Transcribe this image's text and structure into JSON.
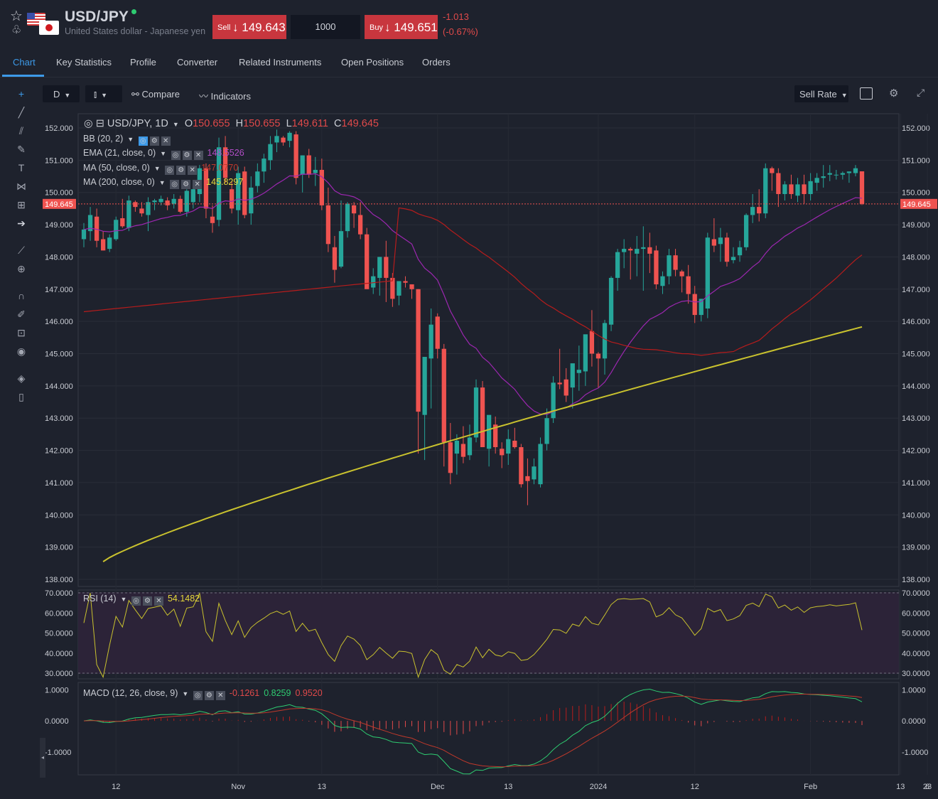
{
  "header": {
    "symbol": "USD/JPY",
    "description": "United States dollar - Japanese yen",
    "sell_label": "Sell",
    "sell_arrow": "↓",
    "sell_price": "149.643",
    "quantity": "1000",
    "buy_label": "Buy",
    "buy_arrow": "↓",
    "buy_price": "149.651",
    "change": "-1.013",
    "change_pct": "(-0.67%)"
  },
  "tabs": [
    "Chart",
    "Key Statistics",
    "Profile",
    "Converter",
    "Related Instruments",
    "Open Positions",
    "Orders"
  ],
  "toolbar": {
    "interval": "D",
    "compare": "Compare",
    "indicators": "Indicators",
    "rate_type": "Sell Rate"
  },
  "legend": {
    "title": "USD/JPY, 1D",
    "o_label": "O",
    "o": "150.655",
    "h_label": "H",
    "h": "150.655",
    "l_label": "L",
    "l": "149.611",
    "c_label": "C",
    "c": "149.645",
    "bb": "BB (20, 2)",
    "ema": "EMA (21, close, 0)",
    "ema_val": "148.5526",
    "ma50": "MA (50, close, 0)",
    "ma50_val": "147.0770",
    "ma200": "MA (200, close, 0)",
    "ma200_val": "145.8297",
    "rsi": "RSI (14)",
    "rsi_val": "54.1482",
    "macd": "MACD (12, 26, close, 9)",
    "macd_hist": "-0.1261",
    "macd_line": "0.8259",
    "macd_signal": "0.9520"
  },
  "colors": {
    "up": "#26a69a",
    "down": "#ef5350",
    "ema": "#9c27b0",
    "ma50": "#b71c1c",
    "ma200": "#c9c22e",
    "accent": "#3d9ae8"
  },
  "chart_data": {
    "type": "candlestick",
    "price_axis": {
      "ylim": [
        138,
        152
      ],
      "ticks": [
        "152.000",
        "151.000",
        "150.000",
        "149.000",
        "148.000",
        "147.000",
        "146.000",
        "145.000",
        "144.000",
        "143.000",
        "142.000",
        "141.000",
        "140.000",
        "139.000",
        "138.000"
      ]
    },
    "last_price_label": "149.645",
    "x_ticks": [
      "12",
      "Nov",
      "13",
      "Dec",
      "13",
      "2024",
      "12",
      "Feb",
      "13",
      "23",
      "6"
    ],
    "candles": [
      [
        148.55,
        149.05,
        148.3,
        148.85
      ],
      [
        148.8,
        149.55,
        148.5,
        149.3
      ],
      [
        149.25,
        149.5,
        148.3,
        148.5
      ],
      [
        148.55,
        148.8,
        148.2,
        148.2
      ],
      [
        148.25,
        148.7,
        148.15,
        148.6
      ],
      [
        148.55,
        149.25,
        148.5,
        149.15
      ],
      [
        149.2,
        149.8,
        148.9,
        148.95
      ],
      [
        148.9,
        149.9,
        148.8,
        149.75
      ],
      [
        149.7,
        149.75,
        149.4,
        149.55
      ],
      [
        149.5,
        149.7,
        149.25,
        149.35
      ],
      [
        149.3,
        149.85,
        148.8,
        149.7
      ],
      [
        149.7,
        149.8,
        149.45,
        149.75
      ],
      [
        149.7,
        149.9,
        149.6,
        149.8
      ],
      [
        149.75,
        149.85,
        149.45,
        149.6
      ],
      [
        149.65,
        149.95,
        149.5,
        149.8
      ],
      [
        149.8,
        149.9,
        149.35,
        149.4
      ],
      [
        149.4,
        150.1,
        149.25,
        150.05
      ],
      [
        149.7,
        150.3,
        149.5,
        150.1
      ],
      [
        149.95,
        150.85,
        149.7,
        150.75
      ],
      [
        150.75,
        150.9,
        149.2,
        149.5
      ],
      [
        149.25,
        149.6,
        148.75,
        149.05
      ],
      [
        149.15,
        151.7,
        148.95,
        151.4
      ],
      [
        151.4,
        151.75,
        150.3,
        150.45
      ],
      [
        150.1,
        150.35,
        149.35,
        149.5
      ],
      [
        149.45,
        150.8,
        149.0,
        150.6
      ],
      [
        150.65,
        150.8,
        149.2,
        149.3
      ],
      [
        149.35,
        150.5,
        149.0,
        150.15
      ],
      [
        150.2,
        150.9,
        150.0,
        150.65
      ],
      [
        150.65,
        151.2,
        150.3,
        151.05
      ],
      [
        151.0,
        151.75,
        150.7,
        151.5
      ],
      [
        151.55,
        151.95,
        151.25,
        151.75
      ],
      [
        151.7,
        151.75,
        151.45,
        151.55
      ],
      [
        151.6,
        151.9,
        151.4,
        151.85
      ],
      [
        151.8,
        151.9,
        150.25,
        150.45
      ],
      [
        150.55,
        151.15,
        150.0,
        151.15
      ],
      [
        151.15,
        151.35,
        150.45,
        150.55
      ],
      [
        150.6,
        151.1,
        150.2,
        150.7
      ],
      [
        150.7,
        151.05,
        149.45,
        149.6
      ],
      [
        149.6,
        150.15,
        148.15,
        148.4
      ],
      [
        148.3,
        148.65,
        147.2,
        147.6
      ],
      [
        147.7,
        149.75,
        147.65,
        148.8
      ],
      [
        148.8,
        149.7,
        148.6,
        149.65
      ],
      [
        149.6,
        149.7,
        148.9,
        149.35
      ],
      [
        149.3,
        149.7,
        148.55,
        148.7
      ],
      [
        148.7,
        148.9,
        147.85,
        147.0
      ],
      [
        147.05,
        147.65,
        146.85,
        147.4
      ],
      [
        147.35,
        148.0,
        146.8,
        148.0
      ],
      [
        148.0,
        148.5,
        146.6,
        147.35
      ],
      [
        147.35,
        147.5,
        146.45,
        146.7
      ],
      [
        146.8,
        147.0,
        146.5,
        147.25
      ],
      [
        147.25,
        147.4,
        147.05,
        147.2
      ],
      [
        147.15,
        147.15,
        146.7,
        147.0
      ],
      [
        147.0,
        147.0,
        141.9,
        143.2
      ],
      [
        143.1,
        144.75,
        141.7,
        144.9
      ],
      [
        144.85,
        146.4,
        143.3,
        145.9
      ],
      [
        146.15,
        146.25,
        144.85,
        145.15
      ],
      [
        145.15,
        145.3,
        141.5,
        142.25
      ],
      [
        142.25,
        142.85,
        140.95,
        141.3
      ],
      [
        141.9,
        142.5,
        141.25,
        142.3
      ],
      [
        142.2,
        142.75,
        141.6,
        141.8
      ],
      [
        141.85,
        142.8,
        141.7,
        142.4
      ],
      [
        142.4,
        144.2,
        142.25,
        143.95
      ],
      [
        143.95,
        144.15,
        142.3,
        142.1
      ],
      [
        142.05,
        142.75,
        141.5,
        143.1
      ],
      [
        142.8,
        143.05,
        141.9,
        142.1
      ],
      [
        142.05,
        142.25,
        141.45,
        141.85
      ],
      [
        141.9,
        142.65,
        141.55,
        142.35
      ],
      [
        142.3,
        142.7,
        142.05,
        142.1
      ],
      [
        142.1,
        142.2,
        140.85,
        140.95
      ],
      [
        141.2,
        141.75,
        140.3,
        141.05
      ],
      [
        141.1,
        141.75,
        140.95,
        141.5
      ],
      [
        140.95,
        142.4,
        140.85,
        142.2
      ],
      [
        142.2,
        143.3,
        142.0,
        143.0
      ],
      [
        143.0,
        144.3,
        142.85,
        144.1
      ],
      [
        144.1,
        145.15,
        143.9,
        144.05
      ],
      [
        144.2,
        144.55,
        143.5,
        143.7
      ],
      [
        143.95,
        144.45,
        143.3,
        144.7
      ],
      [
        144.4,
        145.25,
        143.85,
        144.5
      ],
      [
        144.45,
        145.5,
        144.0,
        145.6
      ],
      [
        145.7,
        146.35,
        144.6,
        145.0
      ],
      [
        145.0,
        145.05,
        143.95,
        144.85
      ],
      [
        144.85,
        146.05,
        144.35,
        145.95
      ],
      [
        145.9,
        147.4,
        145.7,
        147.35
      ],
      [
        147.35,
        148.25,
        146.95,
        148.15
      ],
      [
        148.15,
        148.55,
        147.65,
        148.25
      ],
      [
        148.25,
        148.3,
        147.3,
        148.2
      ],
      [
        148.1,
        148.65,
        147.4,
        148.25
      ],
      [
        148.25,
        148.95,
        146.95,
        148.3
      ],
      [
        148.3,
        148.75,
        147.5,
        148.1
      ],
      [
        148.2,
        148.35,
        147.0,
        147.15
      ],
      [
        147.1,
        147.55,
        146.85,
        147.4
      ],
      [
        147.4,
        148.25,
        147.15,
        148.05
      ],
      [
        148.05,
        148.25,
        147.4,
        147.6
      ],
      [
        147.55,
        147.6,
        146.9,
        147.4
      ],
      [
        147.4,
        147.75,
        146.55,
        146.85
      ],
      [
        146.85,
        147.1,
        145.95,
        146.2
      ],
      [
        146.2,
        146.7,
        146.0,
        146.7
      ],
      [
        146.4,
        148.75,
        146.1,
        148.6
      ],
      [
        148.55,
        149.2,
        148.15,
        148.35
      ],
      [
        148.4,
        148.9,
        147.85,
        148.6
      ],
      [
        148.6,
        148.75,
        147.7,
        147.85
      ],
      [
        147.9,
        148.3,
        147.8,
        148.0
      ],
      [
        148.05,
        148.5,
        147.85,
        148.3
      ],
      [
        148.3,
        149.35,
        148.2,
        149.3
      ],
      [
        149.3,
        149.95,
        149.05,
        149.55
      ],
      [
        149.55,
        150.1,
        149.1,
        149.35
      ],
      [
        149.35,
        150.9,
        149.2,
        150.75
      ],
      [
        150.75,
        150.8,
        150.05,
        150.6
      ],
      [
        150.6,
        150.75,
        149.55,
        149.95
      ],
      [
        149.95,
        150.35,
        149.75,
        150.25
      ],
      [
        150.25,
        150.55,
        149.8,
        149.95
      ],
      [
        149.9,
        150.45,
        149.7,
        150.25
      ],
      [
        150.25,
        150.55,
        149.65,
        149.95
      ],
      [
        149.95,
        150.6,
        149.75,
        150.35
      ],
      [
        150.3,
        150.6,
        150.05,
        150.45
      ],
      [
        150.45,
        150.85,
        150.15,
        150.5
      ],
      [
        150.55,
        150.85,
        150.35,
        150.6
      ],
      [
        150.55,
        150.7,
        150.4,
        150.55
      ],
      [
        150.55,
        150.65,
        150.4,
        150.6
      ],
      [
        150.6,
        150.65,
        150.3,
        150.65
      ],
      [
        150.6,
        150.85,
        150.5,
        150.75
      ],
      [
        150.655,
        150.655,
        149.611,
        149.645
      ]
    ],
    "rsi": {
      "ylim": [
        30,
        70
      ],
      "ticks": [
        "70.0000",
        "60.0000",
        "50.0000",
        "40.0000",
        "30.0000"
      ]
    },
    "macd": {
      "ylim": [
        -1.6,
        1.1
      ],
      "ticks": [
        "1.0000",
        "0.0000",
        "-1.0000"
      ]
    }
  }
}
